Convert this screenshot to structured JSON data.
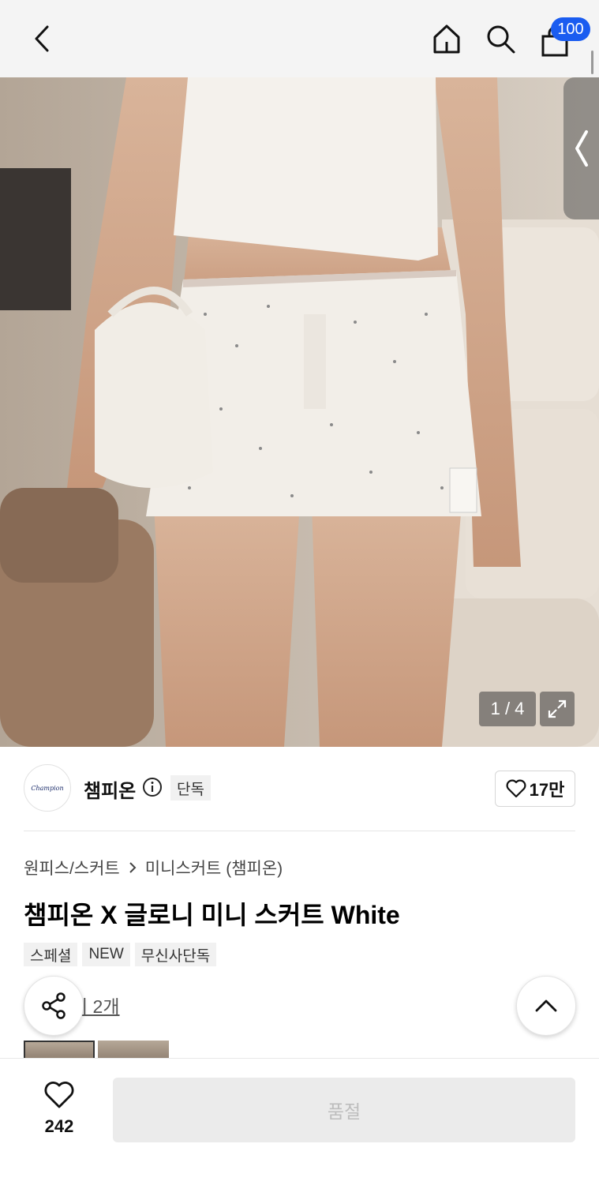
{
  "header": {
    "cart_count": "100"
  },
  "gallery": {
    "counter": "1 / 4"
  },
  "brand": {
    "logo_text": "Champion",
    "name": "챔피온",
    "exclusive_tag": "단독",
    "like_count": "17만"
  },
  "product": {
    "breadcrumb": [
      "원피스/스커트",
      "미니스커트 (챔피온)"
    ],
    "title": "챔피온 X 글로니 미니 스커트 White",
    "tags": [
      "스페셜",
      "NEW",
      "무신사단독"
    ],
    "review_link": "기 2개"
  },
  "bottom_bar": {
    "wish_count": "242",
    "buy_label": "품절"
  },
  "colors": {
    "badge": "#1a5cf0",
    "soldout_bg": "#ebebeb"
  }
}
